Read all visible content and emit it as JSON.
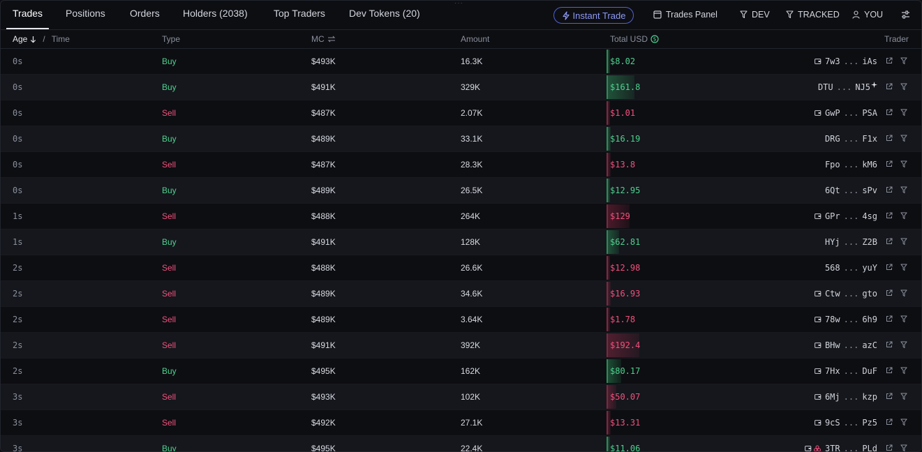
{
  "tabs": [
    {
      "label": "Trades",
      "active": true
    },
    {
      "label": "Positions",
      "active": false
    },
    {
      "label": "Orders",
      "active": false
    },
    {
      "label": "Holders (2038)",
      "active": false
    },
    {
      "label": "Top Traders",
      "active": false
    },
    {
      "label": "Dev Tokens (20)",
      "active": false
    }
  ],
  "toolbar": {
    "instant_trade": "Instant Trade",
    "trades_panel": "Trades Panel",
    "dev": "DEV",
    "tracked": "TRACKED",
    "you": "YOU"
  },
  "columns": {
    "age": "Age",
    "sep": "/",
    "time": "Time",
    "type": "Type",
    "mc": "MC",
    "amount": "Amount",
    "total_usd": "Total USD",
    "trader": "Trader"
  },
  "colors": {
    "buy": "#4ed18f",
    "sell": "#f2517d",
    "accent": "#5261d8"
  },
  "rows": [
    {
      "age": "0s",
      "type": "Buy",
      "mc": "$493K",
      "amount": "16.3K",
      "usd": "$8.02",
      "usd_fraction": 0.02,
      "trader_a": "7w3",
      "trader_b": "iAs",
      "badge": "wallet-icon"
    },
    {
      "age": "0s",
      "type": "Buy",
      "mc": "$491K",
      "amount": "329K",
      "usd": "$161.8",
      "usd_fraction": 0.42,
      "trader_a": "DTU",
      "trader_b": "NJ5",
      "badge": "sparkle-icon"
    },
    {
      "age": "0s",
      "type": "Sell",
      "mc": "$487K",
      "amount": "2.07K",
      "usd": "$1.01",
      "usd_fraction": 0.01,
      "trader_a": "GwP",
      "trader_b": "PSA",
      "badge": "wallet-icon"
    },
    {
      "age": "0s",
      "type": "Buy",
      "mc": "$489K",
      "amount": "33.1K",
      "usd": "$16.19",
      "usd_fraction": 0.04,
      "trader_a": "DRG",
      "trader_b": "F1x",
      "badge": ""
    },
    {
      "age": "0s",
      "type": "Sell",
      "mc": "$487K",
      "amount": "28.3K",
      "usd": "$13.8",
      "usd_fraction": 0.04,
      "trader_a": "Fpo",
      "trader_b": "kM6",
      "badge": ""
    },
    {
      "age": "0s",
      "type": "Buy",
      "mc": "$489K",
      "amount": "26.5K",
      "usd": "$12.95",
      "usd_fraction": 0.03,
      "trader_a": "6Qt",
      "trader_b": "sPv",
      "badge": ""
    },
    {
      "age": "1s",
      "type": "Sell",
      "mc": "$488K",
      "amount": "264K",
      "usd": "$129",
      "usd_fraction": 0.34,
      "trader_a": "GPr",
      "trader_b": "4sg",
      "badge": "wallet-icon"
    },
    {
      "age": "1s",
      "type": "Buy",
      "mc": "$491K",
      "amount": "128K",
      "usd": "$62.81",
      "usd_fraction": 0.18,
      "trader_a": "HYj",
      "trader_b": "Z2B",
      "badge": ""
    },
    {
      "age": "2s",
      "type": "Sell",
      "mc": "$488K",
      "amount": "26.6K",
      "usd": "$12.98",
      "usd_fraction": 0.03,
      "trader_a": "568",
      "trader_b": "yuY",
      "badge": ""
    },
    {
      "age": "2s",
      "type": "Sell",
      "mc": "$489K",
      "amount": "34.6K",
      "usd": "$16.93",
      "usd_fraction": 0.04,
      "trader_a": "Ctw",
      "trader_b": "gto",
      "badge": "wallet-icon"
    },
    {
      "age": "2s",
      "type": "Sell",
      "mc": "$489K",
      "amount": "3.64K",
      "usd": "$1.78",
      "usd_fraction": 0.01,
      "trader_a": "78w",
      "trader_b": "6h9",
      "badge": "wallet-icon"
    },
    {
      "age": "2s",
      "type": "Sell",
      "mc": "$491K",
      "amount": "392K",
      "usd": "$192.4",
      "usd_fraction": 0.5,
      "trader_a": "BHw",
      "trader_b": "azC",
      "badge": "wallet-icon"
    },
    {
      "age": "2s",
      "type": "Buy",
      "mc": "$495K",
      "amount": "162K",
      "usd": "$80.17",
      "usd_fraction": 0.21,
      "trader_a": "7Hx",
      "trader_b": "DuF",
      "badge": "wallet-icon"
    },
    {
      "age": "3s",
      "type": "Sell",
      "mc": "$493K",
      "amount": "102K",
      "usd": "$50.07",
      "usd_fraction": 0.13,
      "trader_a": "6Mj",
      "trader_b": "kzp",
      "badge": "wallet-icon"
    },
    {
      "age": "3s",
      "type": "Sell",
      "mc": "$492K",
      "amount": "27.1K",
      "usd": "$13.31",
      "usd_fraction": 0.04,
      "trader_a": "9cS",
      "trader_b": "Pz5",
      "badge": "wallet-icon"
    },
    {
      "age": "3s",
      "type": "Buy",
      "mc": "$495K",
      "amount": "22.4K",
      "usd": "$11.06",
      "usd_fraction": 0.03,
      "trader_a": "3TR",
      "trader_b": "PLd",
      "badge": "wallet-cluster-icon"
    }
  ]
}
